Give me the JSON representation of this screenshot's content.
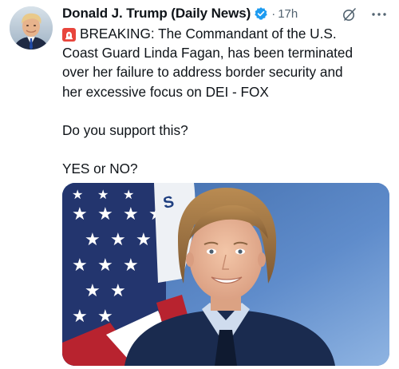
{
  "author": {
    "display_name": "Donald J. Trump (Daily News)",
    "avatar_icon": "profile-avatar",
    "verified_icon": "verified-badge-icon"
  },
  "meta": {
    "separator": "·",
    "timestamp": "17h"
  },
  "actions": {
    "grok_icon": "grok-icon",
    "more_icon": "more-options-icon"
  },
  "post": {
    "emoji_icon": "police-siren-icon",
    "line1": "BREAKING: The Commandant of the U.S.",
    "line2": "Coast Guard Linda Fagan, has been terminated",
    "line3": "over her failure to address border security and",
    "line4": "her excessive focus on DEI - FOX",
    "question": "Do you support this?",
    "answer_prompt": "YES or NO?"
  },
  "media": {
    "type": "photo",
    "flag_letter": "S"
  },
  "colors": {
    "verified_blue": "#1d9bf0",
    "secondary_text": "#536471",
    "siren_red": "#e8453c"
  }
}
